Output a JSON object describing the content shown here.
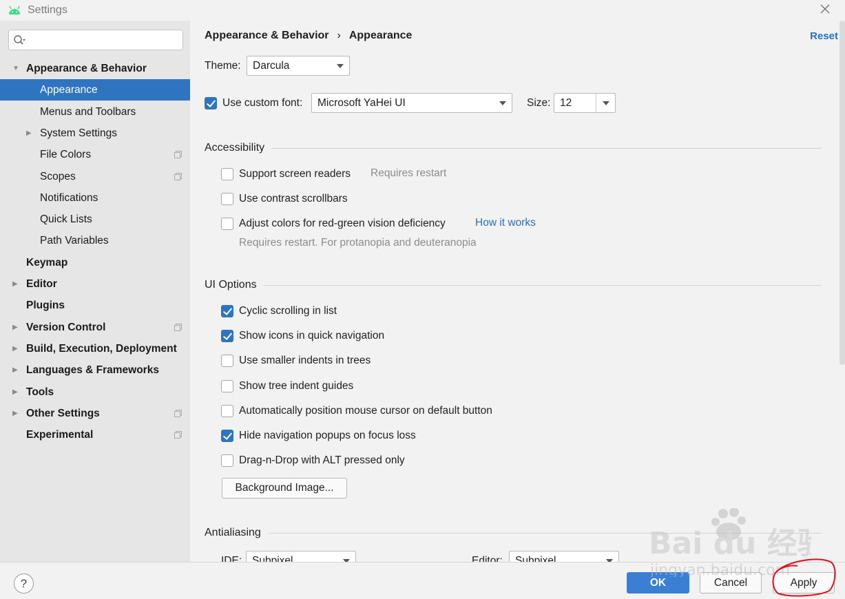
{
  "window": {
    "title": "Settings"
  },
  "search": {
    "placeholder": ""
  },
  "sidebar": {
    "items": [
      {
        "label": "Appearance & Behavior",
        "bold": true,
        "arrow": "expanded",
        "indent": 0
      },
      {
        "label": "Appearance",
        "bold": false,
        "selected": true,
        "indent": 1
      },
      {
        "label": "Menus and Toolbars",
        "bold": false,
        "indent": 1
      },
      {
        "label": "System Settings",
        "bold": false,
        "arrow": "collapsed",
        "indent": 1
      },
      {
        "label": "File Colors",
        "bold": false,
        "indent": 1,
        "project": true
      },
      {
        "label": "Scopes",
        "bold": false,
        "indent": 1,
        "project": true
      },
      {
        "label": "Notifications",
        "bold": false,
        "indent": 1
      },
      {
        "label": "Quick Lists",
        "bold": false,
        "indent": 1
      },
      {
        "label": "Path Variables",
        "bold": false,
        "indent": 1
      },
      {
        "label": "Keymap",
        "bold": true,
        "indent": 0
      },
      {
        "label": "Editor",
        "bold": true,
        "arrow": "collapsed",
        "indent": 0
      },
      {
        "label": "Plugins",
        "bold": true,
        "indent": 0
      },
      {
        "label": "Version Control",
        "bold": true,
        "arrow": "collapsed",
        "indent": 0,
        "project": true
      },
      {
        "label": "Build, Execution, Deployment",
        "bold": true,
        "arrow": "collapsed",
        "indent": 0
      },
      {
        "label": "Languages & Frameworks",
        "bold": true,
        "arrow": "collapsed",
        "indent": 0
      },
      {
        "label": "Tools",
        "bold": true,
        "arrow": "collapsed",
        "indent": 0
      },
      {
        "label": "Other Settings",
        "bold": true,
        "arrow": "collapsed",
        "indent": 0,
        "project": true
      },
      {
        "label": "Experimental",
        "bold": true,
        "indent": 0,
        "project": true
      }
    ]
  },
  "breadcrumb": {
    "parent": "Appearance & Behavior",
    "separator": "›",
    "current": "Appearance"
  },
  "reset_label": "Reset",
  "theme": {
    "label": "Theme:",
    "value": "Darcula"
  },
  "font": {
    "checkbox_label": "Use custom font:",
    "checked": true,
    "value": "Microsoft YaHei UI",
    "size_label": "Size:",
    "size_value": "12"
  },
  "accessibility": {
    "title": "Accessibility",
    "screen_readers": {
      "label": "Support screen readers",
      "checked": false,
      "hint": "Requires restart"
    },
    "contrast_scrollbars": {
      "label": "Use contrast scrollbars",
      "checked": false
    },
    "color_deficiency": {
      "label": "Adjust colors for red-green vision deficiency",
      "checked": false,
      "link": "How it works",
      "hint": "Requires restart. For protanopia and deuteranopia"
    }
  },
  "ui_options": {
    "title": "UI Options",
    "items": [
      {
        "label": "Cyclic scrolling in list",
        "checked": true
      },
      {
        "label": "Show icons in quick navigation",
        "checked": true
      },
      {
        "label": "Use smaller indents in trees",
        "checked": false
      },
      {
        "label": "Show tree indent guides",
        "checked": false
      },
      {
        "label": "Automatically position mouse cursor on default button",
        "checked": false
      },
      {
        "label": "Hide navigation popups on focus loss",
        "checked": true
      },
      {
        "label": "Drag-n-Drop with ALT pressed only",
        "checked": false
      }
    ],
    "background_button": "Background Image..."
  },
  "antialiasing": {
    "title": "Antialiasing",
    "ide_label": "IDE:",
    "ide_value": "Subpixel",
    "editor_label": "Editor:",
    "editor_value": "Subpixel"
  },
  "footer": {
    "help": "?",
    "ok": "OK",
    "cancel": "Cancel",
    "apply": "Apply"
  },
  "watermark": {
    "brand": "Bai du 经验",
    "url": "jingyan.baidu.com"
  },
  "colors": {
    "selection": "#2e74c0",
    "link": "#2470c2",
    "ok_button": "#3b7fd4",
    "android_green": "#3ddc84",
    "scribble": "#e0101a"
  }
}
